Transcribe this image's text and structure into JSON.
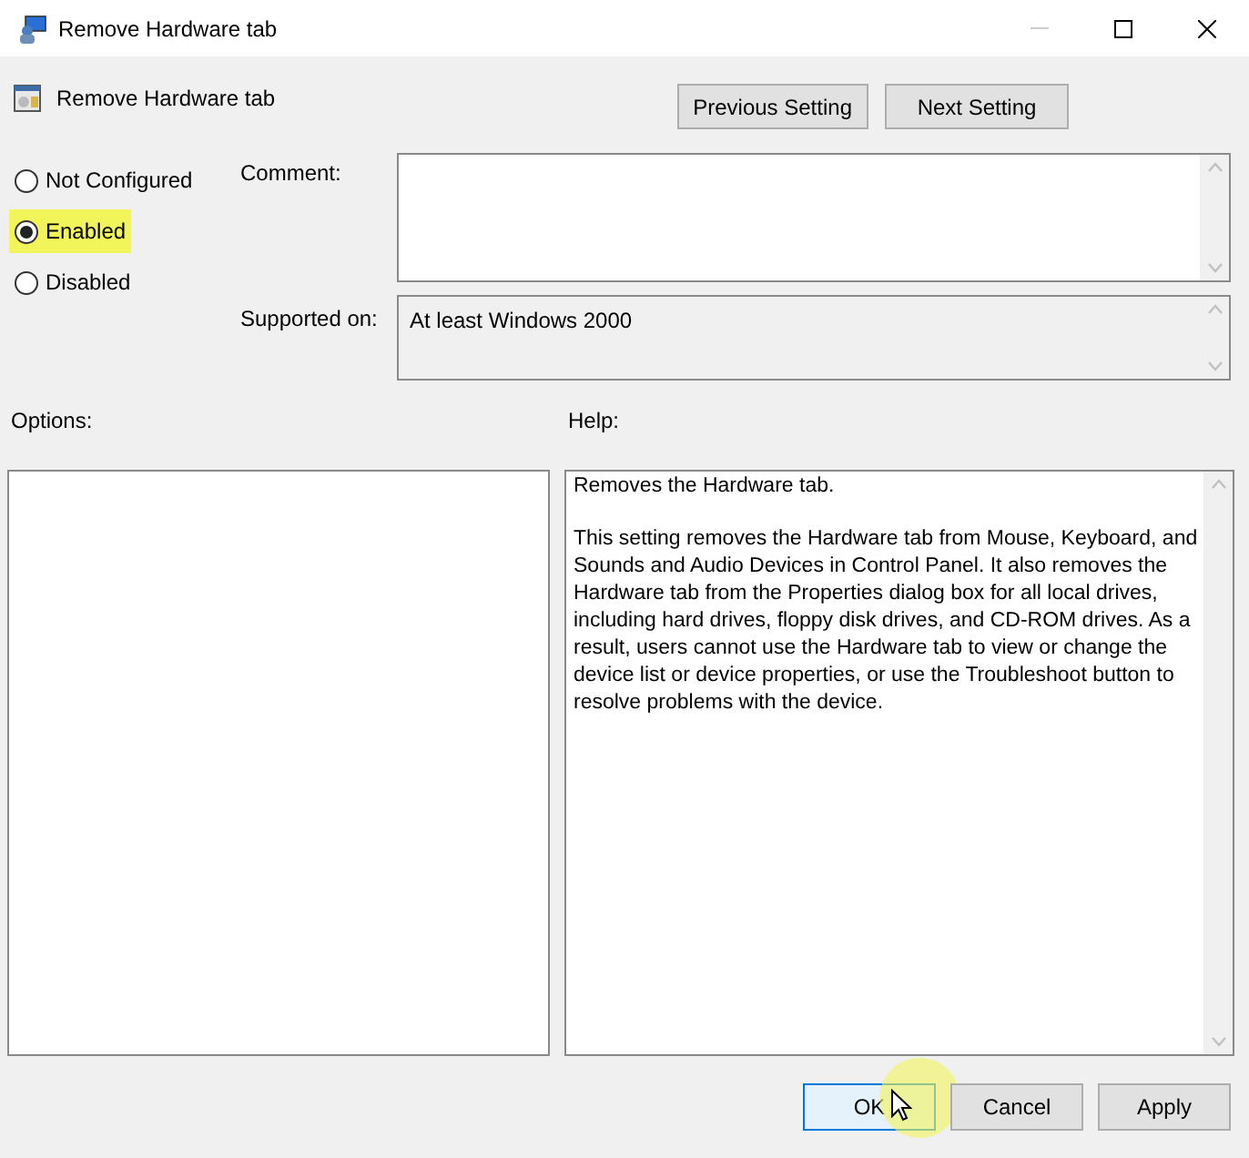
{
  "window": {
    "title": "Remove Hardware tab"
  },
  "header": {
    "setting_name": "Remove Hardware tab"
  },
  "nav_buttons": [
    "Previous Setting",
    "Next Setting"
  ],
  "states": [
    {
      "label": "Not Configured",
      "selected": false,
      "highlighted": false
    },
    {
      "label": "Enabled",
      "selected": true,
      "highlighted": true
    },
    {
      "label": "Disabled",
      "selected": false,
      "highlighted": false
    }
  ],
  "comment": {
    "label": "Comment:"
  },
  "supported_on": {
    "label": "Supported on:",
    "value": "At least Windows 2000"
  },
  "options": {
    "label": "Options:"
  },
  "help": {
    "label": "Help:",
    "paragraphs": [
      "Removes the Hardware tab.",
      "This setting removes the Hardware tab from Mouse, Keyboard, and Sounds and Audio Devices in Control Panel. It also removes the Hardware tab from the Properties dialog box for all local drives, including hard drives, floppy disk drives, and CD-ROM drives. As a result, users cannot use the Hardware tab to view or change the device list or device properties, or use the Troubleshoot button to resolve problems with the device."
    ]
  },
  "footer_buttons": [
    {
      "label": "OK",
      "default": true,
      "highlighted": true
    },
    {
      "label": "Cancel",
      "default": false,
      "highlighted": false
    },
    {
      "label": "Apply",
      "default": false,
      "highlighted": false
    }
  ]
}
